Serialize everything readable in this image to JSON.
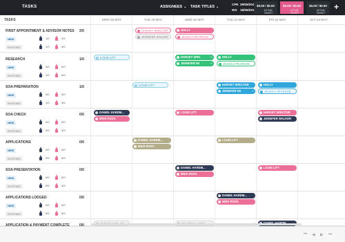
{
  "topbar": {
    "title": "TASKS",
    "assignees_label": "ASSIGNEES",
    "task_titles_label": "TASK TITLES",
    "cpe_label": "CPE",
    "cpe_date": "29/05/2015",
    "ws_label": "WS",
    "ws_date": "18/05/2015",
    "money": [
      {
        "amount": "$0.00 / $0.00",
        "sub": "ACTUAL   TARGET",
        "color": "#2a2f36"
      },
      {
        "amount": "$0.00 / $0.00",
        "sub": "ACTUAL   TARGET",
        "color": "#e15a8a"
      },
      {
        "amount": "$0.00 / $0.00",
        "sub": "ACTUAL   TARGET",
        "color": "#2a2f36"
      }
    ],
    "add_symbol": "+"
  },
  "header": {
    "tasks_label": "TASKS",
    "days": [
      "MON 18 MAY",
      "TUE 19 MAY",
      "WED 20 MAY",
      "THU 21 MAY",
      "FRI 22 MAY",
      "SAT 23 MAY"
    ]
  },
  "rows": [
    {
      "name": "FIRST APPOINTMENT & ADVISOR NOTES",
      "ratio": "2/0",
      "new": {
        "m": "1/0",
        "f": "0/0"
      },
      "existing": {
        "m": "1/0",
        "f": "0/0"
      }
    },
    {
      "name": "RESEARCH",
      "ratio": "1/0",
      "new": {
        "m": "0/0",
        "f": "0/0"
      },
      "existing": {
        "m": "1/0",
        "f": "0/0"
      }
    },
    {
      "name": "SOA PREPARATION",
      "ratio": "1/0",
      "new": {
        "m": "0/0",
        "f": "0/0"
      },
      "existing": {
        "m": "1/0",
        "f": "0/0"
      }
    },
    {
      "name": "SOA CHECK",
      "ratio": "0/0",
      "new": {
        "m": "0/0",
        "f": "0/0"
      },
      "existing": {
        "m": "0/0",
        "f": "0/0"
      }
    },
    {
      "name": "APPLICATIONS",
      "ratio": "0/0",
      "new": {
        "m": "0/0",
        "f": "0/0"
      },
      "existing": {
        "m": "0/0",
        "f": "0/0"
      }
    },
    {
      "name": "SOA PRESENTATION",
      "ratio": "0/0",
      "new": {
        "m": "0/0",
        "f": "0/0"
      },
      "existing": {
        "m": "0/0",
        "f": "0/0"
      }
    },
    {
      "name": "APPLICATIONS LODGED",
      "ratio": "0/0",
      "new": {
        "m": "0/0",
        "f": "0/0"
      },
      "existing": {
        "m": "0/0",
        "f": "0/0"
      }
    },
    {
      "name": "APPLICATION & PAYMENT COMPLETE",
      "ratio": "0/0"
    }
  ],
  "labels": {
    "new": "NEW",
    "existing": "EXISTING"
  },
  "chips": [
    {
      "text": "HOLLY",
      "style": "pink"
    },
    {
      "text": "HARVEY SPECTOR",
      "style": "o-pink"
    },
    {
      "text": "JENNIFER WALKER",
      "style": "lgray"
    },
    {
      "text": "JESSICA PEARSON",
      "style": "o-pink"
    },
    {
      "text": "LOUIS LITT",
      "style": "lblue"
    },
    {
      "text": "HARVEY SPEI",
      "style": "green"
    },
    {
      "text": "HOLLY",
      "style": "green"
    },
    {
      "text": "JENNIFER WI",
      "style": "green"
    },
    {
      "text": "JESSICA PEARSON",
      "style": "o-green"
    },
    {
      "text": "LOUIS LITT",
      "style": "lblue"
    },
    {
      "text": "HARVEY SPECTOR",
      "style": "blue"
    },
    {
      "text": "HOLLY",
      "style": "blue"
    },
    {
      "text": "JENNIFER WI",
      "style": "blue"
    },
    {
      "text": "JESSICA PEARSON",
      "style": "o-blue"
    },
    {
      "text": "DANIEL HARDM...",
      "style": "navy"
    },
    {
      "text": "MIKE ROSS",
      "style": "pink"
    },
    {
      "text": "LOUIS LITT",
      "style": "pink"
    },
    {
      "text": "HARVEY SPECTOR",
      "style": "pink"
    },
    {
      "text": "JENNIFER WALKER",
      "style": "navy"
    },
    {
      "text": "DANIEL HARDM...",
      "style": "olive"
    },
    {
      "text": "MIKE ROSS",
      "style": "olive"
    },
    {
      "text": "LOUIS LITT",
      "style": "olive"
    },
    {
      "text": "DANIEL HARDM...",
      "style": "navy"
    },
    {
      "text": "MIKE ROSS",
      "style": "pink"
    },
    {
      "text": "LOUIS LITT",
      "style": "pink"
    },
    {
      "text": "DANIEL HARDM...",
      "style": "navy"
    },
    {
      "text": "MIKE ROSS",
      "style": "pink"
    },
    {
      "text": "KARAGLANIS, JO...",
      "style": "lgray"
    },
    {
      "text": "CHAPMAN, JOSH",
      "style": "lgray"
    },
    {
      "text": "DANIEL HARDM...",
      "style": "navy"
    }
  ],
  "nav": {
    "first": "⏮",
    "prev": "◀",
    "next": "▶",
    "last": "⏭"
  }
}
